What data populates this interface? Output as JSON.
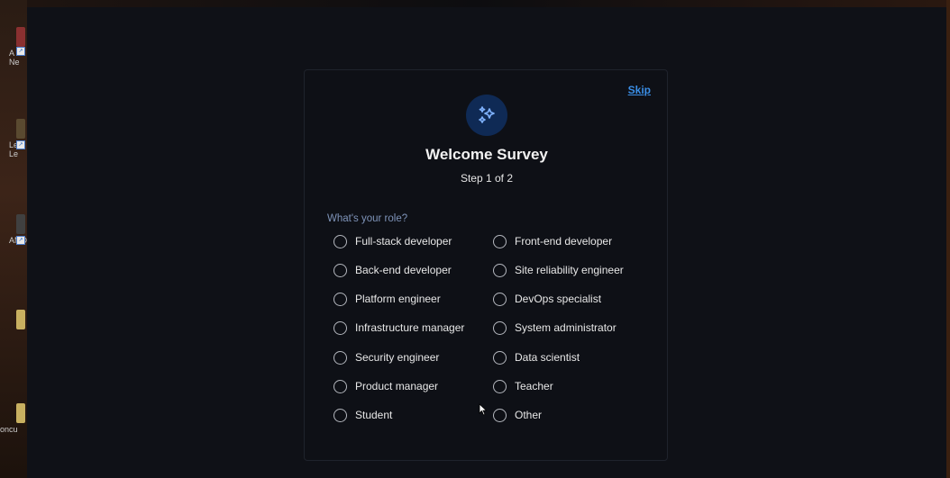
{
  "desktop": {
    "icons": [
      {
        "label": "A",
        "label2": "Ne",
        "color": "#8a3030"
      },
      {
        "label": "Lea",
        "label2": "Le",
        "color": "#5a4a30"
      },
      {
        "label": "AMD",
        "label2": "",
        "color": "#404040"
      },
      {
        "label": "",
        "label2": "",
        "color": "#c8b060"
      },
      {
        "label": "oncu",
        "label2": "",
        "color": "#c8b060"
      }
    ]
  },
  "dialog": {
    "skip_label": "Skip",
    "title": "Welcome Survey",
    "step": "Step 1 of 2",
    "question": "What's your role?",
    "badge_icon": "sparkles-icon",
    "accent_color": "#3a8ee6",
    "options_left": [
      "Full-stack developer",
      "Back-end developer",
      "Platform engineer",
      "Infrastructure manager",
      "Security engineer",
      "Product manager",
      "Student"
    ],
    "options_right": [
      "Front-end developer",
      "Site reliability engineer",
      "DevOps specialist",
      "System administrator",
      "Data scientist",
      "Teacher",
      "Other"
    ]
  }
}
